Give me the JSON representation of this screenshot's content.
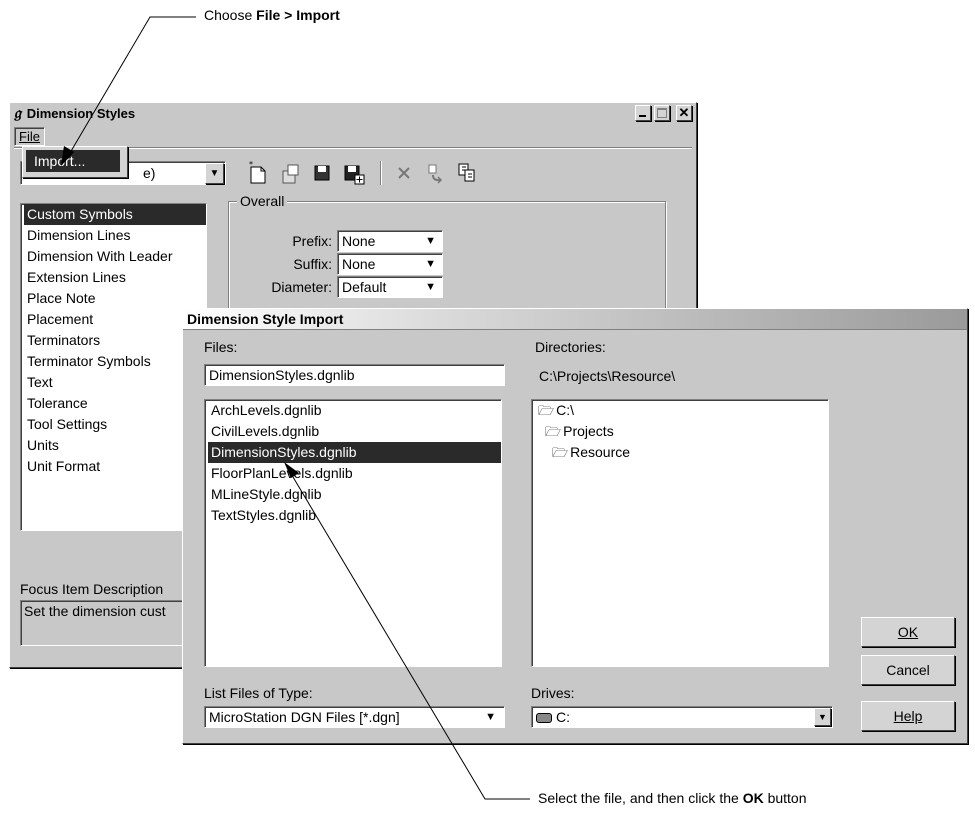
{
  "callouts": {
    "top": {
      "prefix": "Choose ",
      "bold": "File > Import"
    },
    "bottom": {
      "prefix": "Select the file, and then click the ",
      "bold": "OK",
      "suffix": " button"
    }
  },
  "styles_window": {
    "title": "Dimension Styles",
    "menu_file": "File",
    "menu_import": "Import...",
    "style_dropdown_partial": "e)",
    "overall_group": "Overall",
    "prefix_label": "Prefix:",
    "prefix_value": "None",
    "suffix_label": "Suffix:",
    "suffix_value": "None",
    "diameter_label": "Diameter:",
    "diameter_value": "Default",
    "categories": [
      "Custom Symbols",
      "Dimension Lines",
      "Dimension With Leader",
      "Extension Lines",
      "Place Note",
      "Placement",
      "Terminators",
      "Terminator Symbols",
      "Text",
      "Tolerance",
      "Tool Settings",
      "Units",
      "Unit Format"
    ],
    "selected_category_index": 0,
    "focus_label": "Focus Item Description",
    "focus_text": "Set the dimension cust"
  },
  "import_dialog": {
    "title": "Dimension Style Import",
    "files_label": "Files:",
    "files_value": "DimensionStyles.dgnlib",
    "files": [
      "ArchLevels.dgnlib",
      "CivilLevels.dgnlib",
      "DimensionStyles.dgnlib",
      "FloorPlanLevels.dgnlib",
      "MLineStyle.dgnlib",
      "TextStyles.dgnlib"
    ],
    "selected_file_index": 2,
    "directories_label": "Directories:",
    "directories_path": "C:\\Projects\\Resource\\",
    "directories": [
      "C:\\",
      "Projects",
      "Resource"
    ],
    "list_type_label": "List Files of Type:",
    "list_type_value": "MicroStation DGN Files [*.dgn]",
    "drives_label": "Drives:",
    "drives_value": "C:",
    "ok": "OK",
    "cancel": "Cancel",
    "help": "Help"
  },
  "colors": {
    "selection": "#2a2a2a",
    "face": "#c8c8c8"
  }
}
